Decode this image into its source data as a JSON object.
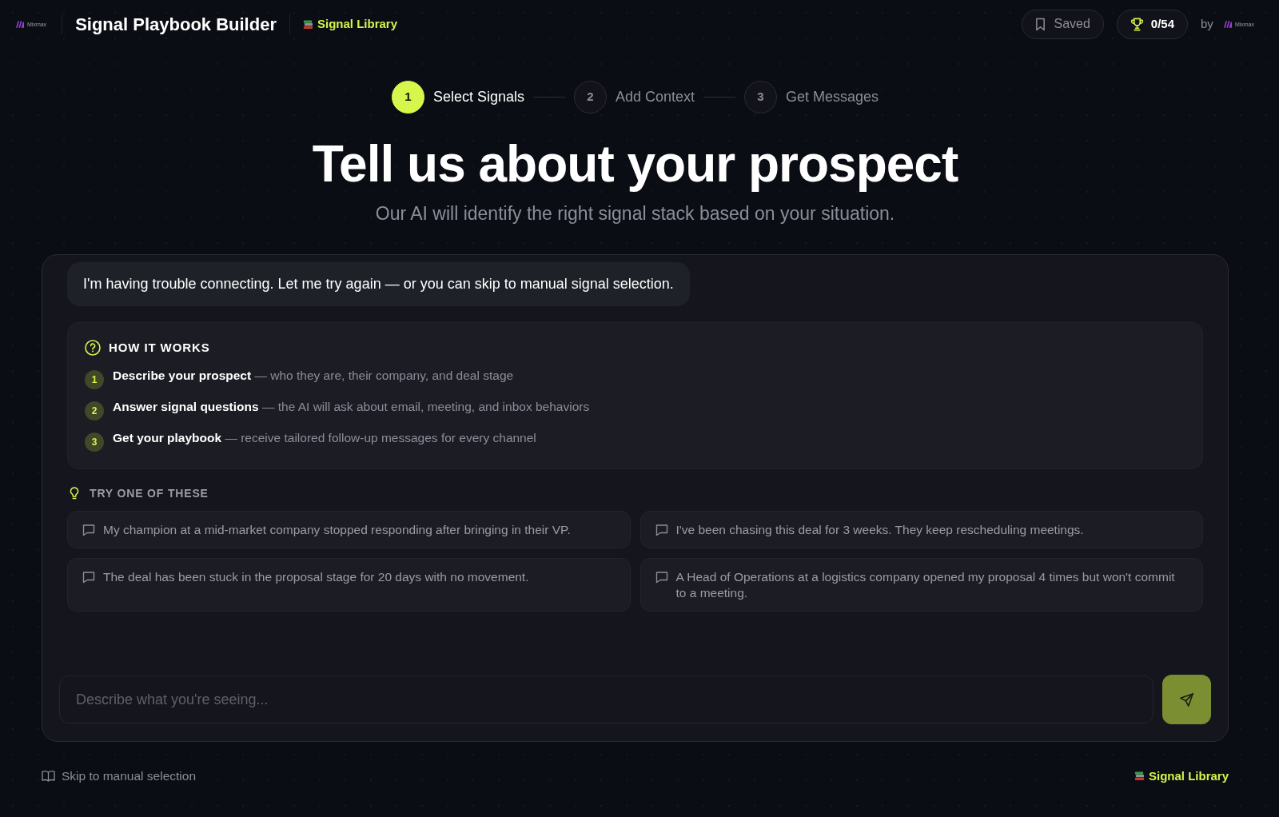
{
  "header": {
    "logo": {
      "text": "Mixmax"
    },
    "title": "Signal Playbook Builder",
    "library_link": "Signal Library",
    "saved_button": "Saved",
    "score_button": "0/54",
    "byline": "by",
    "by_logo": {
      "text": "Mixmax"
    }
  },
  "stepper": [
    {
      "number": "1",
      "label": "Select Signals",
      "selected": true
    },
    {
      "number": "2",
      "label": "Add Context",
      "selected": false
    },
    {
      "number": "3",
      "label": "Get Messages",
      "selected": false
    }
  ],
  "heading": "Tell us about your prospect",
  "subheading": "Our AI will identify the right signal stack based on your situation.",
  "chat": {
    "message": "I'm having trouble connecting. Let me try again — or you can skip to manual signal selection.",
    "how_it_works": {
      "title": "HOW IT WORKS",
      "steps": [
        {
          "number": "1",
          "text": "**Describe your prospect** — who they are, their company, and deal stage"
        },
        {
          "number": "2",
          "text": "**Answer signal questions** — the AI will ask about email, meeting, and inbox behaviors"
        },
        {
          "number": "3",
          "text": "**Get your playbook** — receive tailored follow-up messages for every channel"
        }
      ]
    },
    "suggestions": {
      "title": "TRY ONE OF THESE",
      "items": [
        "My champion at a mid-market company stopped responding after bringing in their VP.",
        "I've been chasing this deal for 3 weeks. They keep rescheduling meetings.",
        "The deal has been stuck in the proposal stage for 20 days with no movement.",
        "A Head of Operations at a logistics company opened my proposal 4 times but won't commit to a meeting."
      ]
    },
    "input": {
      "placeholder": "Describe what you're seeing..."
    }
  },
  "footer": {
    "skip_link": "Skip to manual selection",
    "library_link": "Signal Library"
  }
}
